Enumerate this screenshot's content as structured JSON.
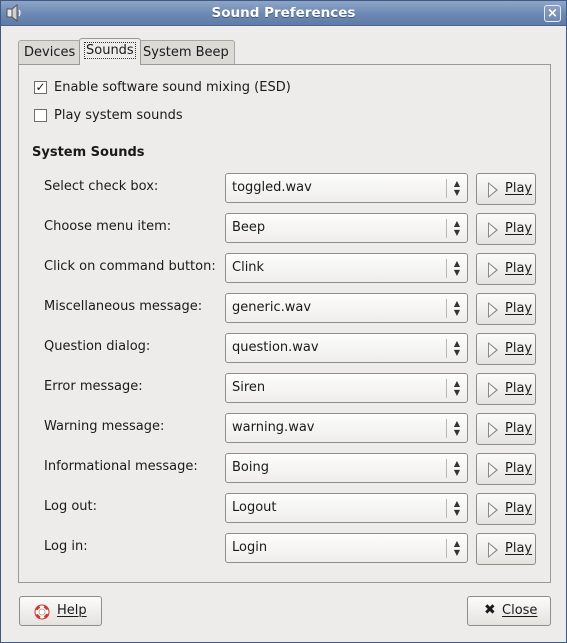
{
  "window": {
    "title": "Sound Preferences",
    "close_glyph": "×",
    "app_icon": "speaker-icon"
  },
  "tabs": [
    {
      "label": "Devices",
      "active": false
    },
    {
      "label": "Sounds",
      "active": true
    },
    {
      "label": "System Beep",
      "active": false
    }
  ],
  "options": {
    "enable_mixing": {
      "label": "Enable software sound mixing (ESD)",
      "checked": true
    },
    "play_system_sounds": {
      "label": "Play system sounds",
      "checked": false
    }
  },
  "section": {
    "heading": "System Sounds"
  },
  "sounds": [
    {
      "label": "Select check box:",
      "value": "toggled.wav"
    },
    {
      "label": "Choose menu item:",
      "value": "Beep"
    },
    {
      "label": "Click on command button:",
      "value": "Clink"
    },
    {
      "label": "Miscellaneous message:",
      "value": "generic.wav"
    },
    {
      "label": "Question dialog:",
      "value": "question.wav"
    },
    {
      "label": "Error message:",
      "value": "Siren"
    },
    {
      "label": "Warning message:",
      "value": "warning.wav"
    },
    {
      "label": "Informational message:",
      "value": "Boing"
    },
    {
      "label": "Log out:",
      "value": "Logout"
    },
    {
      "label": "Log in:",
      "value": "Login"
    }
  ],
  "play_label": "Play",
  "footer": {
    "help_label": "Help",
    "close_label": "Close"
  }
}
